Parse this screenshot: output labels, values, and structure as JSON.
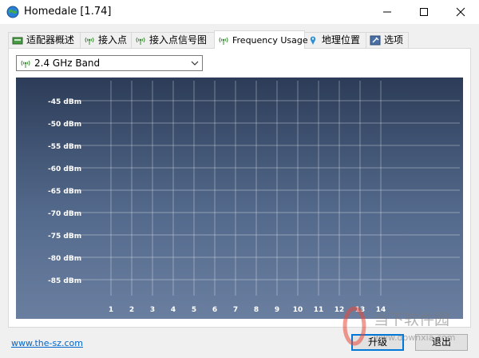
{
  "window": {
    "title": "Homedale [1.74]"
  },
  "tabs": [
    {
      "label": "适配器概述",
      "icon": "adapter-icon",
      "active": false
    },
    {
      "label": "接入点",
      "icon": "antenna-icon",
      "active": false
    },
    {
      "label": "接入点信号图",
      "icon": "antenna-icon",
      "active": false
    },
    {
      "label": "Frequency Usage",
      "icon": "antenna-icon",
      "active": true
    },
    {
      "label": "地理位置",
      "icon": "map-pin-icon",
      "active": false
    },
    {
      "label": "选项",
      "icon": "options-icon",
      "active": false
    }
  ],
  "band_select": {
    "value": "2.4 GHz Band",
    "icon": "antenna-icon"
  },
  "chart_data": {
    "type": "line",
    "y_tick_labels": [
      "-45 dBm",
      "-50 dBm",
      "-55 dBm",
      "-60 dBm",
      "-65 dBm",
      "-70 dBm",
      "-75 dBm",
      "-80 dBm",
      "-85 dBm"
    ],
    "x_tick_labels": [
      "1",
      "2",
      "3",
      "4",
      "5",
      "6",
      "7",
      "8",
      "9",
      "10",
      "11",
      "12",
      "13",
      "14"
    ],
    "series": [],
    "grid": true
  },
  "footer": {
    "link": "www.the-sz.com",
    "upgrade_label": "升级",
    "exit_label": "退出"
  },
  "watermark": {
    "text_cn": "当下软件园",
    "text_url": "www.downxia.com"
  },
  "colors": {
    "graph_top": "#2c3c58",
    "graph_bottom": "#6a7fa0",
    "link": "#0066cc"
  }
}
